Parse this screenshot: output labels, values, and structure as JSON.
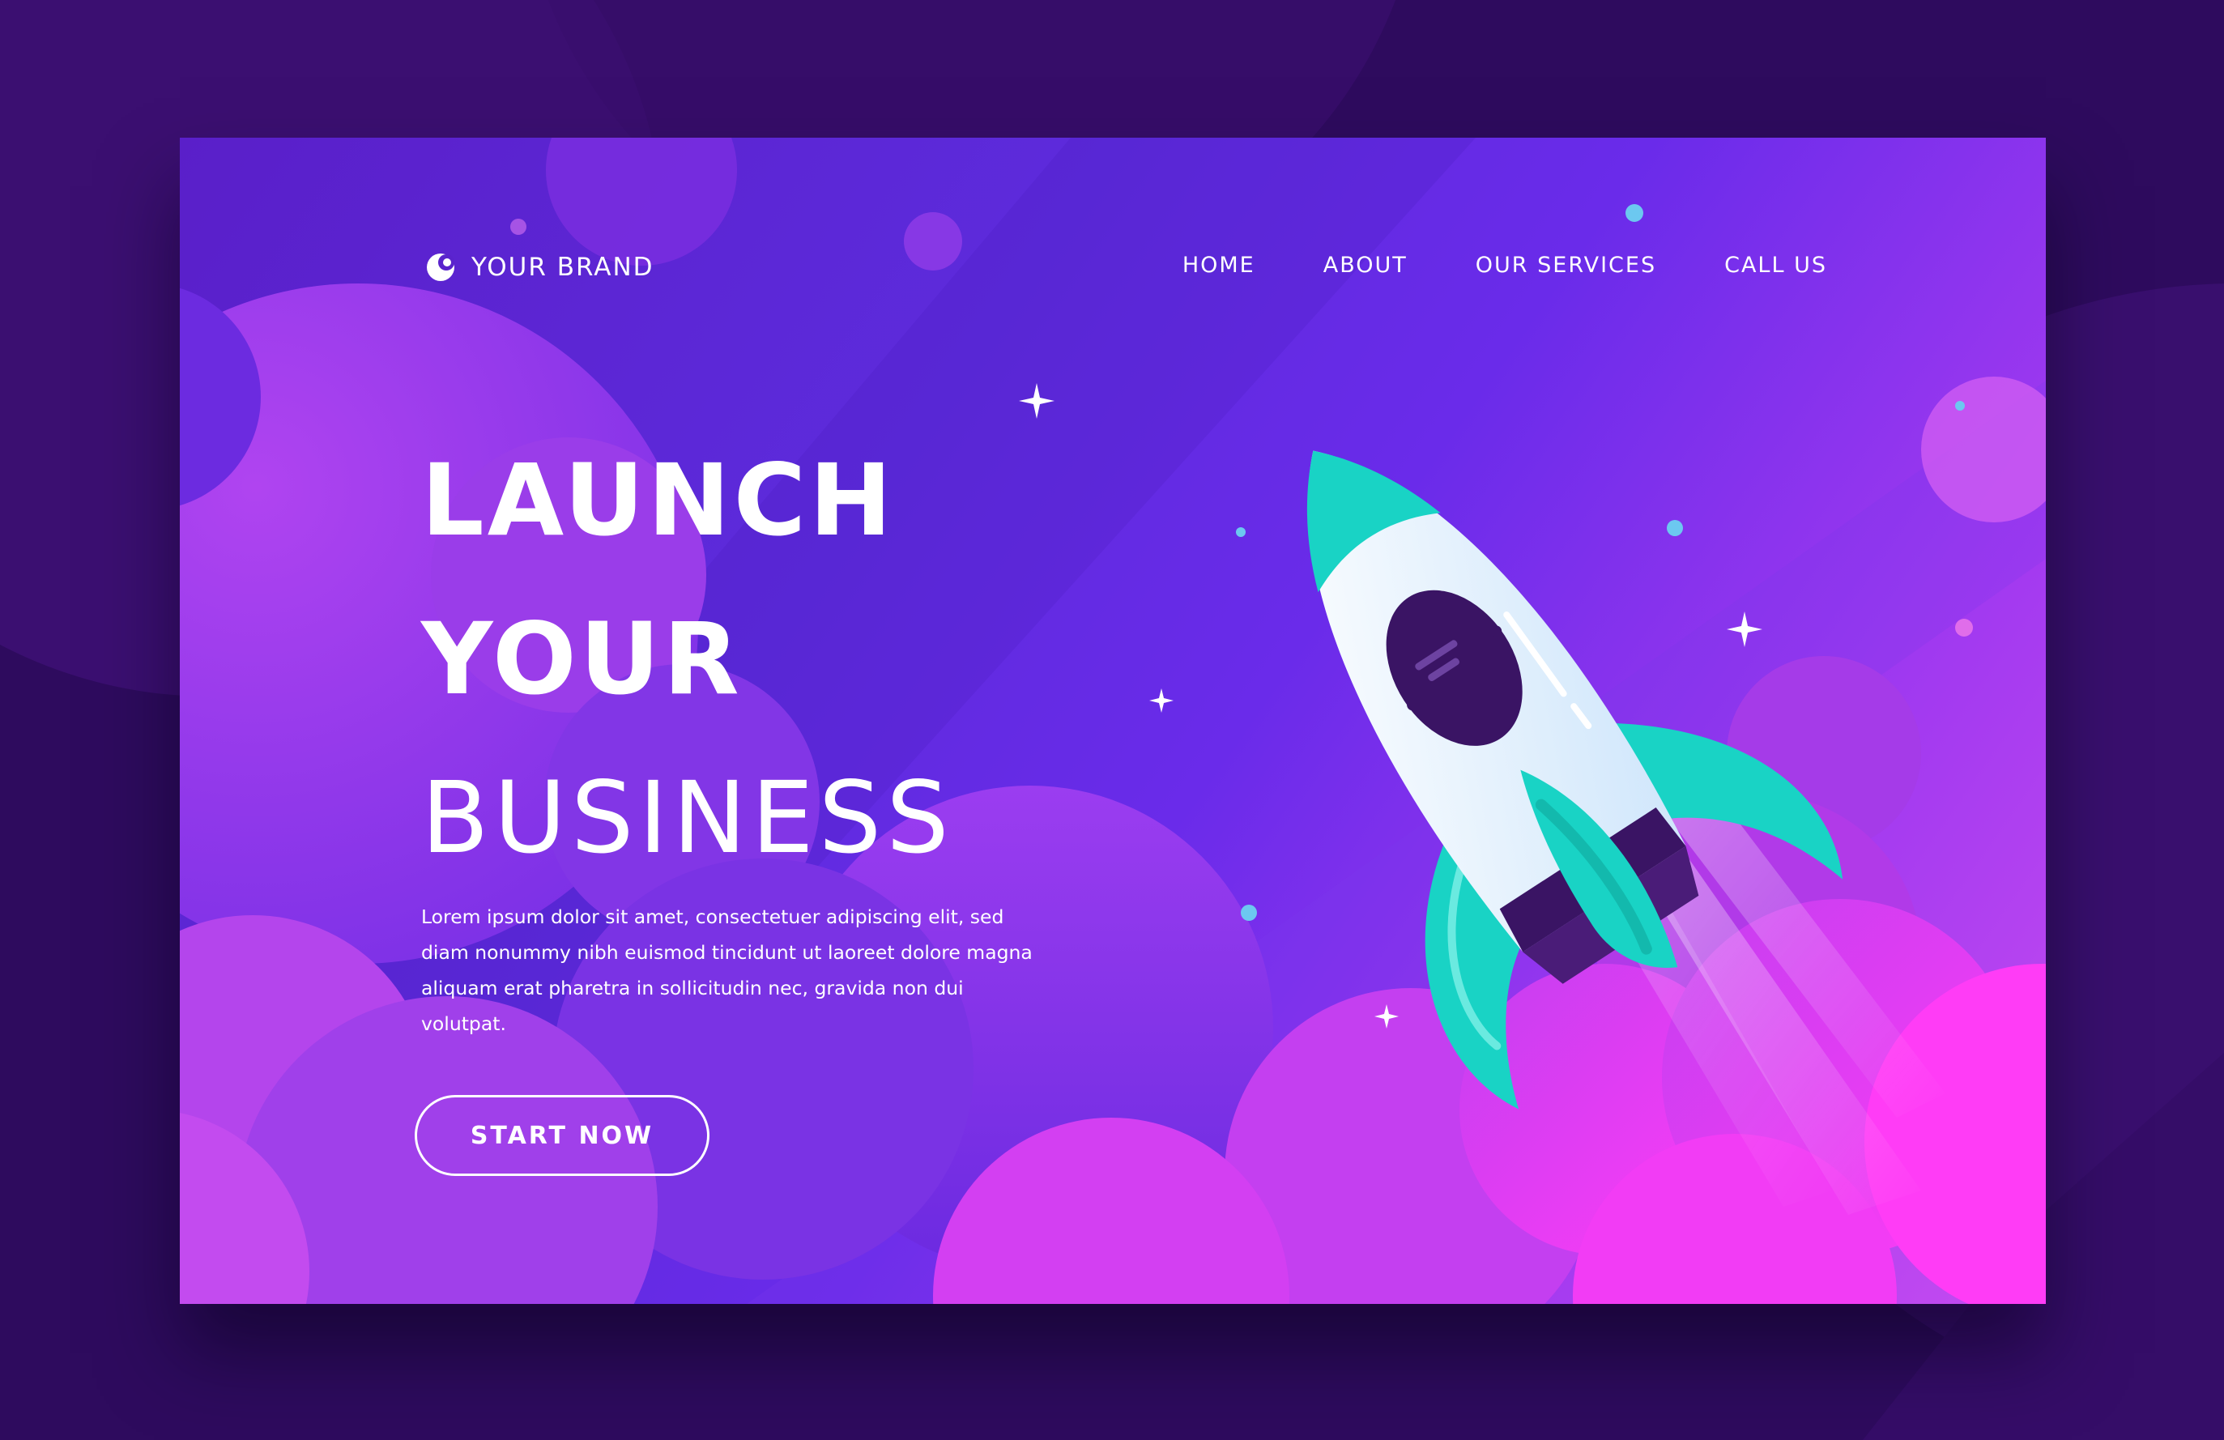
{
  "brand": {
    "name": "YOUR BRAND",
    "logo_icon": "moon-logo-icon"
  },
  "nav": {
    "items": [
      {
        "label": "HOME"
      },
      {
        "label": "ABOUT"
      },
      {
        "label": "OUR SERVICES"
      },
      {
        "label": "CALL US"
      }
    ]
  },
  "hero": {
    "title_line1": "LAUNCH",
    "title_line2": "YOUR",
    "title_line3": "BUSINESS",
    "description": "Lorem ipsum dolor sit amet, consectetuer adipiscing elit, sed diam nonummy nibh euismod tincidunt ut laoreet dolore magna aliquam erat pharetra in sollicitudin nec, gravida non dui volutpat.",
    "cta_label": "START NOW"
  },
  "illustration": {
    "icon": "rocket-icon"
  },
  "colors": {
    "background": "#2e0b5e",
    "accent_teal": "#19d3c5",
    "accent_pink": "#f33bf5",
    "primary_purple": "#5d2bdc"
  }
}
